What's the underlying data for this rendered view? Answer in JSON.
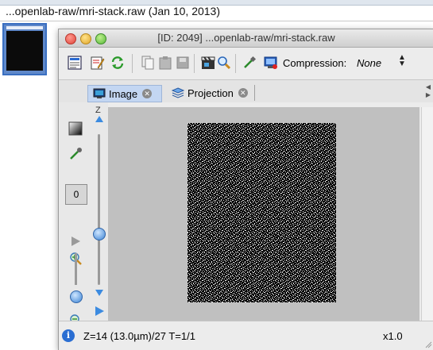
{
  "outer": {
    "title": "...openlab-raw/mri-stack.raw (Jan 10, 2013)"
  },
  "window": {
    "title": "[ID: 2049] ...openlab-raw/mri-stack.raw"
  },
  "toolbar": {
    "compression_label": "Compression:",
    "compression_value": "None",
    "icons": [
      "properties-icon",
      "script-icon",
      "refresh-icon",
      "copy-icon",
      "paste-icon",
      "save-icon",
      "clapperboard-icon",
      "zoom-icon",
      "pipette-icon",
      "compression-icon"
    ]
  },
  "tabs": [
    {
      "label": "Image",
      "active": true
    },
    {
      "label": "Projection",
      "active": false
    }
  ],
  "controls": {
    "z_label": "Z",
    "channel_value": "0"
  },
  "status": {
    "text": "Z=14 (13.0µm)/27 T=1/1",
    "zoom": "x1.0"
  },
  "colors": {
    "accent": "#3b83d4",
    "tab_active": "#c3d6f2",
    "canvas": "#c0c0c0"
  }
}
